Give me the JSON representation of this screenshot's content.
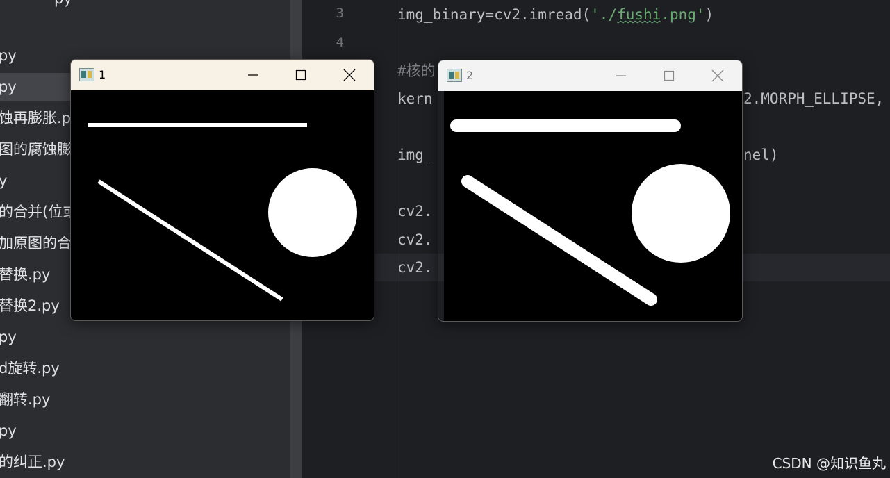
{
  "sidebar": {
    "files": [
      {
        "label": "py",
        "selected": false
      },
      {
        "label": "py",
        "selected": true
      },
      {
        "label": "蚀再膨胀.py",
        "selected": false
      },
      {
        "label": "图的腐蚀膨胀",
        "selected": false
      },
      {
        "label": "y",
        "selected": false
      },
      {
        "label": "的合并(位或",
        "selected": false
      },
      {
        "label": "加原图的合并",
        "selected": false
      },
      {
        "label": "替换.py",
        "selected": false
      },
      {
        "label": "替换2.py",
        "selected": false
      },
      {
        "label": "py",
        "selected": false
      },
      {
        "label": "d旋转.py",
        "selected": false
      },
      {
        "label": "翻转.py",
        "selected": false
      },
      {
        "label": "py",
        "selected": false
      },
      {
        "label": "的纠正.py",
        "selected": false
      }
    ],
    "top_cut_text": "py"
  },
  "editor": {
    "line_numbers": [
      "3",
      "4"
    ],
    "code": {
      "line3_prefix": "img_binary=cv2.imread(",
      "line3_str_open": "'./",
      "line3_str_word": "fushi",
      "line3_str_close": ".png'",
      "line3_suffix": ")",
      "comment": "#核的",
      "kernel_start": "kern",
      "kernel_end": "2.MORPH_ELLIPSE,",
      "img_start": "img_",
      "img_end": "nel)",
      "cv2_a": "cv2.",
      "cv2_b": "cv2.",
      "cv2_c": "cv2."
    }
  },
  "windows": [
    {
      "title": "1",
      "state": "active",
      "minimize_label": "minimize",
      "maximize_label": "maximize",
      "close_label": "close"
    },
    {
      "title": "2",
      "state": "inactive"
    }
  ],
  "watermark": "CSDN @知识鱼丸",
  "colors": {
    "sidebar_bg": "#2b2d30",
    "editor_bg": "#1e1f22",
    "string": "#6aab73",
    "text": "#bcbec4",
    "active_titlebar": "#f8f1e6",
    "inactive_titlebar": "#f3f3f3"
  }
}
